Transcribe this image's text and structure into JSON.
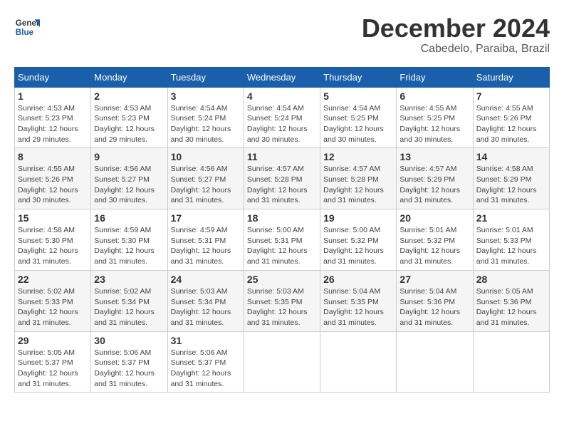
{
  "logo": {
    "line1": "General",
    "line2": "Blue"
  },
  "title": "December 2024",
  "subtitle": "Cabedelo, Paraiba, Brazil",
  "weekdays": [
    "Sunday",
    "Monday",
    "Tuesday",
    "Wednesday",
    "Thursday",
    "Friday",
    "Saturday"
  ],
  "weeks": [
    [
      {
        "day": "1",
        "info": "Sunrise: 4:53 AM\nSunset: 5:23 PM\nDaylight: 12 hours\nand 29 minutes."
      },
      {
        "day": "2",
        "info": "Sunrise: 4:53 AM\nSunset: 5:23 PM\nDaylight: 12 hours\nand 29 minutes."
      },
      {
        "day": "3",
        "info": "Sunrise: 4:54 AM\nSunset: 5:24 PM\nDaylight: 12 hours\nand 30 minutes."
      },
      {
        "day": "4",
        "info": "Sunrise: 4:54 AM\nSunset: 5:24 PM\nDaylight: 12 hours\nand 30 minutes."
      },
      {
        "day": "5",
        "info": "Sunrise: 4:54 AM\nSunset: 5:25 PM\nDaylight: 12 hours\nand 30 minutes."
      },
      {
        "day": "6",
        "info": "Sunrise: 4:55 AM\nSunset: 5:25 PM\nDaylight: 12 hours\nand 30 minutes."
      },
      {
        "day": "7",
        "info": "Sunrise: 4:55 AM\nSunset: 5:26 PM\nDaylight: 12 hours\nand 30 minutes."
      }
    ],
    [
      {
        "day": "8",
        "info": "Sunrise: 4:55 AM\nSunset: 5:26 PM\nDaylight: 12 hours\nand 30 minutes."
      },
      {
        "day": "9",
        "info": "Sunrise: 4:56 AM\nSunset: 5:27 PM\nDaylight: 12 hours\nand 30 minutes."
      },
      {
        "day": "10",
        "info": "Sunrise: 4:56 AM\nSunset: 5:27 PM\nDaylight: 12 hours\nand 31 minutes."
      },
      {
        "day": "11",
        "info": "Sunrise: 4:57 AM\nSunset: 5:28 PM\nDaylight: 12 hours\nand 31 minutes."
      },
      {
        "day": "12",
        "info": "Sunrise: 4:57 AM\nSunset: 5:28 PM\nDaylight: 12 hours\nand 31 minutes."
      },
      {
        "day": "13",
        "info": "Sunrise: 4:57 AM\nSunset: 5:29 PM\nDaylight: 12 hours\nand 31 minutes."
      },
      {
        "day": "14",
        "info": "Sunrise: 4:58 AM\nSunset: 5:29 PM\nDaylight: 12 hours\nand 31 minutes."
      }
    ],
    [
      {
        "day": "15",
        "info": "Sunrise: 4:58 AM\nSunset: 5:30 PM\nDaylight: 12 hours\nand 31 minutes."
      },
      {
        "day": "16",
        "info": "Sunrise: 4:59 AM\nSunset: 5:30 PM\nDaylight: 12 hours\nand 31 minutes."
      },
      {
        "day": "17",
        "info": "Sunrise: 4:59 AM\nSunset: 5:31 PM\nDaylight: 12 hours\nand 31 minutes."
      },
      {
        "day": "18",
        "info": "Sunrise: 5:00 AM\nSunset: 5:31 PM\nDaylight: 12 hours\nand 31 minutes."
      },
      {
        "day": "19",
        "info": "Sunrise: 5:00 AM\nSunset: 5:32 PM\nDaylight: 12 hours\nand 31 minutes."
      },
      {
        "day": "20",
        "info": "Sunrise: 5:01 AM\nSunset: 5:32 PM\nDaylight: 12 hours\nand 31 minutes."
      },
      {
        "day": "21",
        "info": "Sunrise: 5:01 AM\nSunset: 5:33 PM\nDaylight: 12 hours\nand 31 minutes."
      }
    ],
    [
      {
        "day": "22",
        "info": "Sunrise: 5:02 AM\nSunset: 5:33 PM\nDaylight: 12 hours\nand 31 minutes."
      },
      {
        "day": "23",
        "info": "Sunrise: 5:02 AM\nSunset: 5:34 PM\nDaylight: 12 hours\nand 31 minutes."
      },
      {
        "day": "24",
        "info": "Sunrise: 5:03 AM\nSunset: 5:34 PM\nDaylight: 12 hours\nand 31 minutes."
      },
      {
        "day": "25",
        "info": "Sunrise: 5:03 AM\nSunset: 5:35 PM\nDaylight: 12 hours\nand 31 minutes."
      },
      {
        "day": "26",
        "info": "Sunrise: 5:04 AM\nSunset: 5:35 PM\nDaylight: 12 hours\nand 31 minutes."
      },
      {
        "day": "27",
        "info": "Sunrise: 5:04 AM\nSunset: 5:36 PM\nDaylight: 12 hours\nand 31 minutes."
      },
      {
        "day": "28",
        "info": "Sunrise: 5:05 AM\nSunset: 5:36 PM\nDaylight: 12 hours\nand 31 minutes."
      }
    ],
    [
      {
        "day": "29",
        "info": "Sunrise: 5:05 AM\nSunset: 5:37 PM\nDaylight: 12 hours\nand 31 minutes."
      },
      {
        "day": "30",
        "info": "Sunrise: 5:06 AM\nSunset: 5:37 PM\nDaylight: 12 hours\nand 31 minutes."
      },
      {
        "day": "31",
        "info": "Sunrise: 5:06 AM\nSunset: 5:37 PM\nDaylight: 12 hours\nand 31 minutes."
      },
      {
        "day": "",
        "info": ""
      },
      {
        "day": "",
        "info": ""
      },
      {
        "day": "",
        "info": ""
      },
      {
        "day": "",
        "info": ""
      }
    ]
  ]
}
